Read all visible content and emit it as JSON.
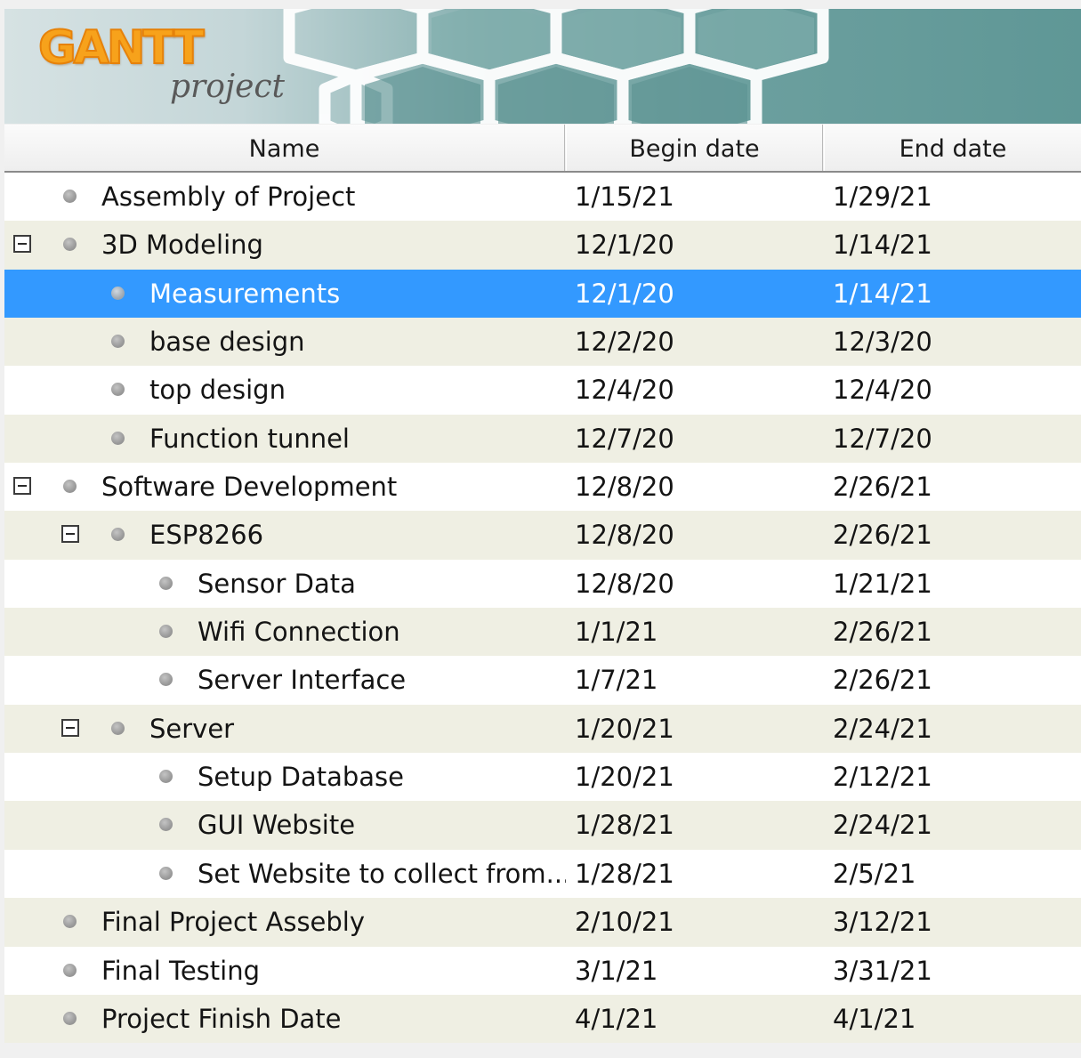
{
  "app": {
    "logo_main": "GANTT",
    "logo_sub": "project"
  },
  "columns": {
    "name": "Name",
    "begin": "Begin date",
    "end": "End date"
  },
  "colors": {
    "selection": "#3399ff",
    "alt_row": "#efefe3",
    "logo_orange": "#f7a21b"
  },
  "tasks": [
    {
      "name": "Assembly of Project",
      "begin": "1/15/21",
      "end": "1/29/21",
      "level": 0,
      "expandable": false
    },
    {
      "name": "3D Modeling",
      "begin": "12/1/20",
      "end": "1/14/21",
      "level": 0,
      "expandable": true
    },
    {
      "name": "Measurements",
      "begin": "12/1/20",
      "end": "1/14/21",
      "level": 1,
      "expandable": false,
      "selected": true
    },
    {
      "name": "base design",
      "begin": "12/2/20",
      "end": "12/3/20",
      "level": 1,
      "expandable": false
    },
    {
      "name": "top design",
      "begin": "12/4/20",
      "end": "12/4/20",
      "level": 1,
      "expandable": false
    },
    {
      "name": "Function tunnel",
      "begin": "12/7/20",
      "end": "12/7/20",
      "level": 1,
      "expandable": false
    },
    {
      "name": "Software Development",
      "begin": "12/8/20",
      "end": "2/26/21",
      "level": 0,
      "expandable": true
    },
    {
      "name": "ESP8266",
      "begin": "12/8/20",
      "end": "2/26/21",
      "level": 1,
      "expandable": true
    },
    {
      "name": "Sensor Data",
      "begin": "12/8/20",
      "end": "1/21/21",
      "level": 2,
      "expandable": false
    },
    {
      "name": "Wifi Connection",
      "begin": "1/1/21",
      "end": "2/26/21",
      "level": 2,
      "expandable": false
    },
    {
      "name": "Server Interface",
      "begin": "1/7/21",
      "end": "2/26/21",
      "level": 2,
      "expandable": false
    },
    {
      "name": "Server",
      "begin": "1/20/21",
      "end": "2/24/21",
      "level": 1,
      "expandable": true
    },
    {
      "name": "Setup Database",
      "begin": "1/20/21",
      "end": "2/12/21",
      "level": 2,
      "expandable": false
    },
    {
      "name": "GUI Website",
      "begin": "1/28/21",
      "end": "2/24/21",
      "level": 2,
      "expandable": false
    },
    {
      "name": "Set Website to collect from...",
      "begin": "1/28/21",
      "end": "2/5/21",
      "level": 2,
      "expandable": false
    },
    {
      "name": "Final Project Assebly",
      "begin": "2/10/21",
      "end": "3/12/21",
      "level": 0,
      "expandable": false
    },
    {
      "name": "Final Testing",
      "begin": "3/1/21",
      "end": "3/31/21",
      "level": 0,
      "expandable": false
    },
    {
      "name": "Project Finish Date",
      "begin": "4/1/21",
      "end": "4/1/21",
      "level": 0,
      "expandable": false
    }
  ]
}
